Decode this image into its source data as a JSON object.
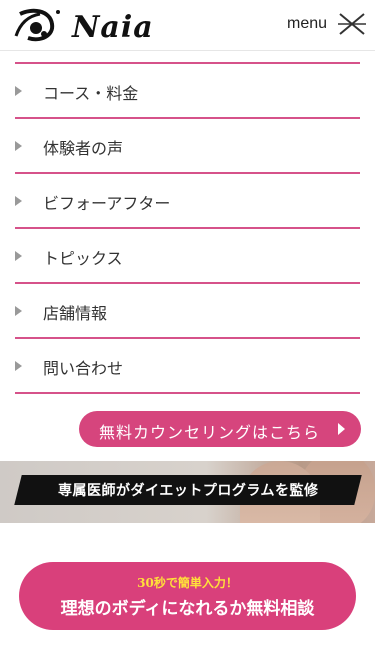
{
  "header": {
    "logo_text": "Naia",
    "menu_label": "menu"
  },
  "nav": {
    "items": [
      {
        "label": "コース・料金"
      },
      {
        "label": "体験者の声"
      },
      {
        "label": "ビフォーアフター"
      },
      {
        "label": "トピックス"
      },
      {
        "label": "店舗情報"
      },
      {
        "label": "問い合わせ"
      }
    ]
  },
  "cta_small": {
    "label": "無料カウンセリングはこちら"
  },
  "banner": {
    "text": "専属医師がダイエットプログラムを監修"
  },
  "cta_big": {
    "sub": "30秒で簡単入力！",
    "main": "理想のボディになれるか無料相談"
  },
  "colors": {
    "accent": "#d6528a",
    "button": "#d9407b",
    "sub_text": "#ffe03a"
  }
}
